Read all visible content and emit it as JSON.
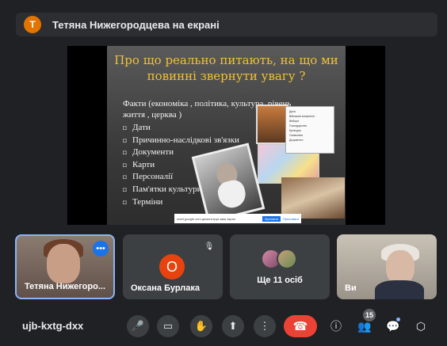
{
  "banner": {
    "avatar_letter": "Т",
    "text": "Тетяна Нижегородцева на екрані"
  },
  "slide": {
    "title": "Про що реально питають, на що ми повинні звернути увагу ?",
    "subtitle": "Факти (економіка , політика, культура, рівень життя , церква )",
    "bullet_symbol": "◘",
    "bullets": [
      "Дати",
      "Причинно-наслідкові зв'язки",
      "Документи",
      "Карти",
      "Персоналії",
      "Пам'ятки культури",
      "Терміни"
    ],
    "popup_items": [
      "Дата",
      "Військові конфлікти",
      "Вибори",
      "Господарство",
      "Культура",
      "Символіка",
      "Документи"
    ],
    "share_bar": {
      "text": "meet.google.com демонструє ваш екран",
      "stop": "Зупинити",
      "hide": "Приховати"
    }
  },
  "tiles": {
    "presenter": {
      "name": "Тетяна Нижегоро...",
      "more": "•••"
    },
    "oksana": {
      "avatar_letter": "О",
      "name": "Оксана Бурлака",
      "mic": "🎙"
    },
    "others": {
      "label": "Ще 11 осіб"
    },
    "self": {
      "name": "Ви"
    }
  },
  "meeting_code": "ujb-kxtg-dxx",
  "controls": {
    "mic": "🎤",
    "camera": "▭",
    "hand": "✋",
    "present": "⬆",
    "more": "⋮",
    "end": "☎",
    "info": "ⓘ",
    "people": "👥",
    "participant_count": "15",
    "chat": "💬",
    "activities": "⬡"
  }
}
